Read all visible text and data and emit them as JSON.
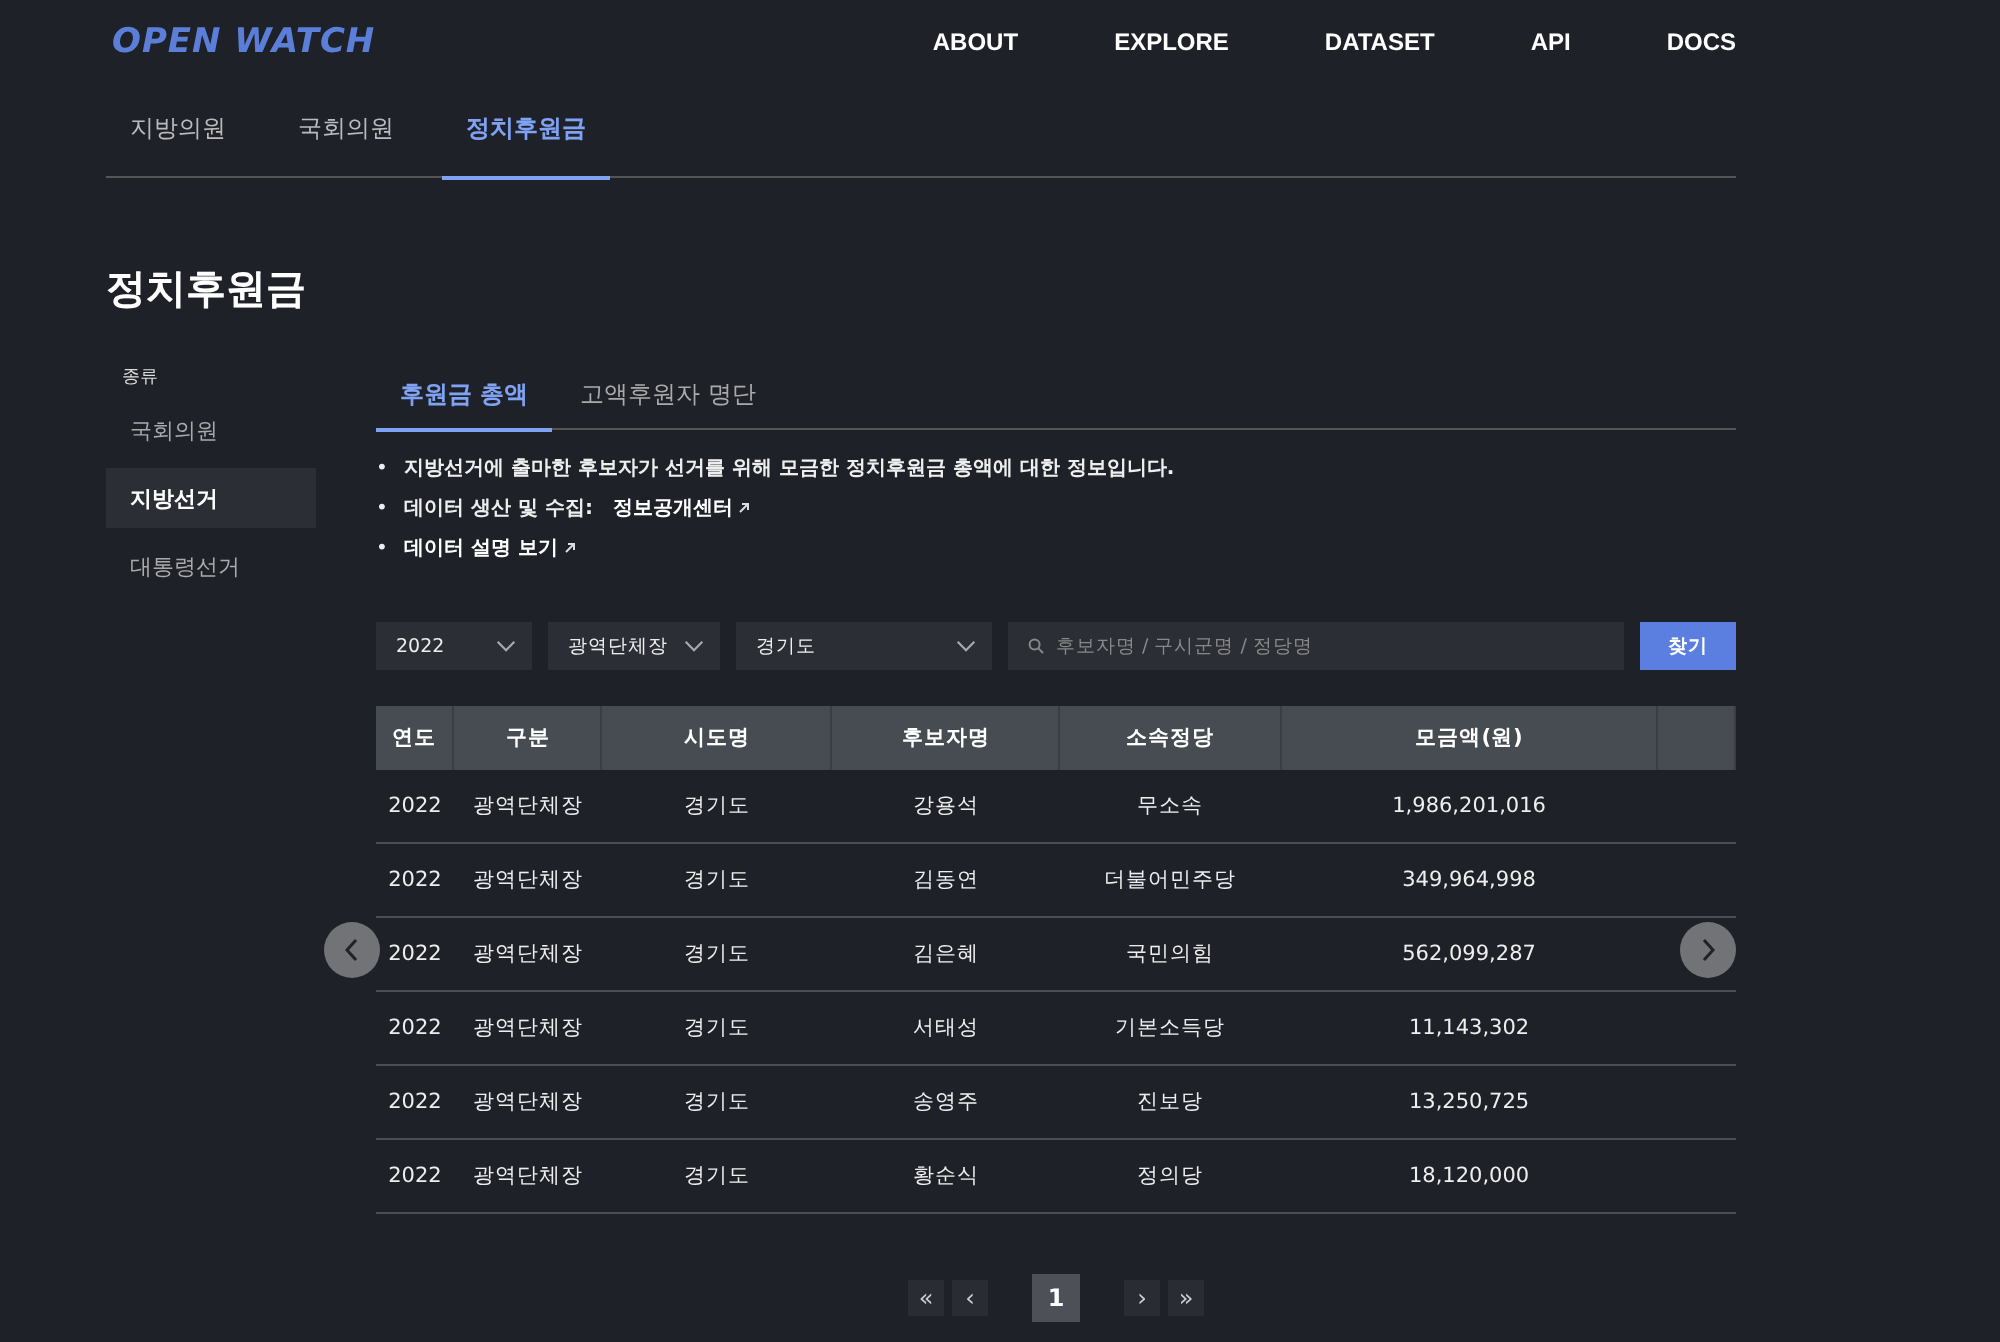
{
  "logo": "OPEN WATCH",
  "nav": [
    "ABOUT",
    "EXPLORE",
    "DATASET",
    "API",
    "DOCS"
  ],
  "section_tabs": [
    {
      "label": "지방의원",
      "selected": false
    },
    {
      "label": "국회의원",
      "selected": false
    },
    {
      "label": "정치후원금",
      "selected": true
    }
  ],
  "page_title": "정치후원금",
  "sidebar": {
    "heading": "종류",
    "items": [
      {
        "label": "국회의원",
        "selected": false
      },
      {
        "label": "지방선거",
        "selected": true
      },
      {
        "label": "대통령선거",
        "selected": false
      }
    ]
  },
  "content_tabs": [
    {
      "label": "후원금 총액",
      "selected": true
    },
    {
      "label": "고액후원자 명단",
      "selected": false
    }
  ],
  "info": [
    {
      "bullet": "•",
      "text": "지방선거에 출마한 후보자가 선거를 위해 모금한 정치후원금 총액에 대한 정보입니다."
    },
    {
      "bullet": "•",
      "text": "데이터 생산 및 수집:",
      "link": "정보공개센터"
    },
    {
      "bullet": "•",
      "link": "데이터 설명 보기"
    }
  ],
  "filters": {
    "year": "2022",
    "type": "광역단체장",
    "region": "경기도",
    "search_placeholder": "후보자명 / 구시군명 / 정당명",
    "search_button": "찾기"
  },
  "table": {
    "columns": [
      "연도",
      "구분",
      "시도명",
      "후보자명",
      "소속정당",
      "모금액(원)"
    ],
    "rows": [
      [
        "2022",
        "광역단체장",
        "경기도",
        "강용석",
        "무소속",
        "1,986,201,016"
      ],
      [
        "2022",
        "광역단체장",
        "경기도",
        "김동연",
        "더불어민주당",
        "349,964,998"
      ],
      [
        "2022",
        "광역단체장",
        "경기도",
        "김은혜",
        "국민의힘",
        "562,099,287"
      ],
      [
        "2022",
        "광역단체장",
        "경기도",
        "서태성",
        "기본소득당",
        "11,143,302"
      ],
      [
        "2022",
        "광역단체장",
        "경기도",
        "송영주",
        "진보당",
        "13,250,725"
      ],
      [
        "2022",
        "광역단체장",
        "경기도",
        "황순식",
        "정의당",
        "18,120,000"
      ]
    ]
  },
  "pagination": [
    {
      "label": "«",
      "selected": false
    },
    {
      "label": "‹",
      "selected": false
    },
    {
      "label": "1",
      "selected": true
    },
    {
      "label": "›",
      "selected": false
    },
    {
      "label": "»",
      "selected": false
    }
  ]
}
